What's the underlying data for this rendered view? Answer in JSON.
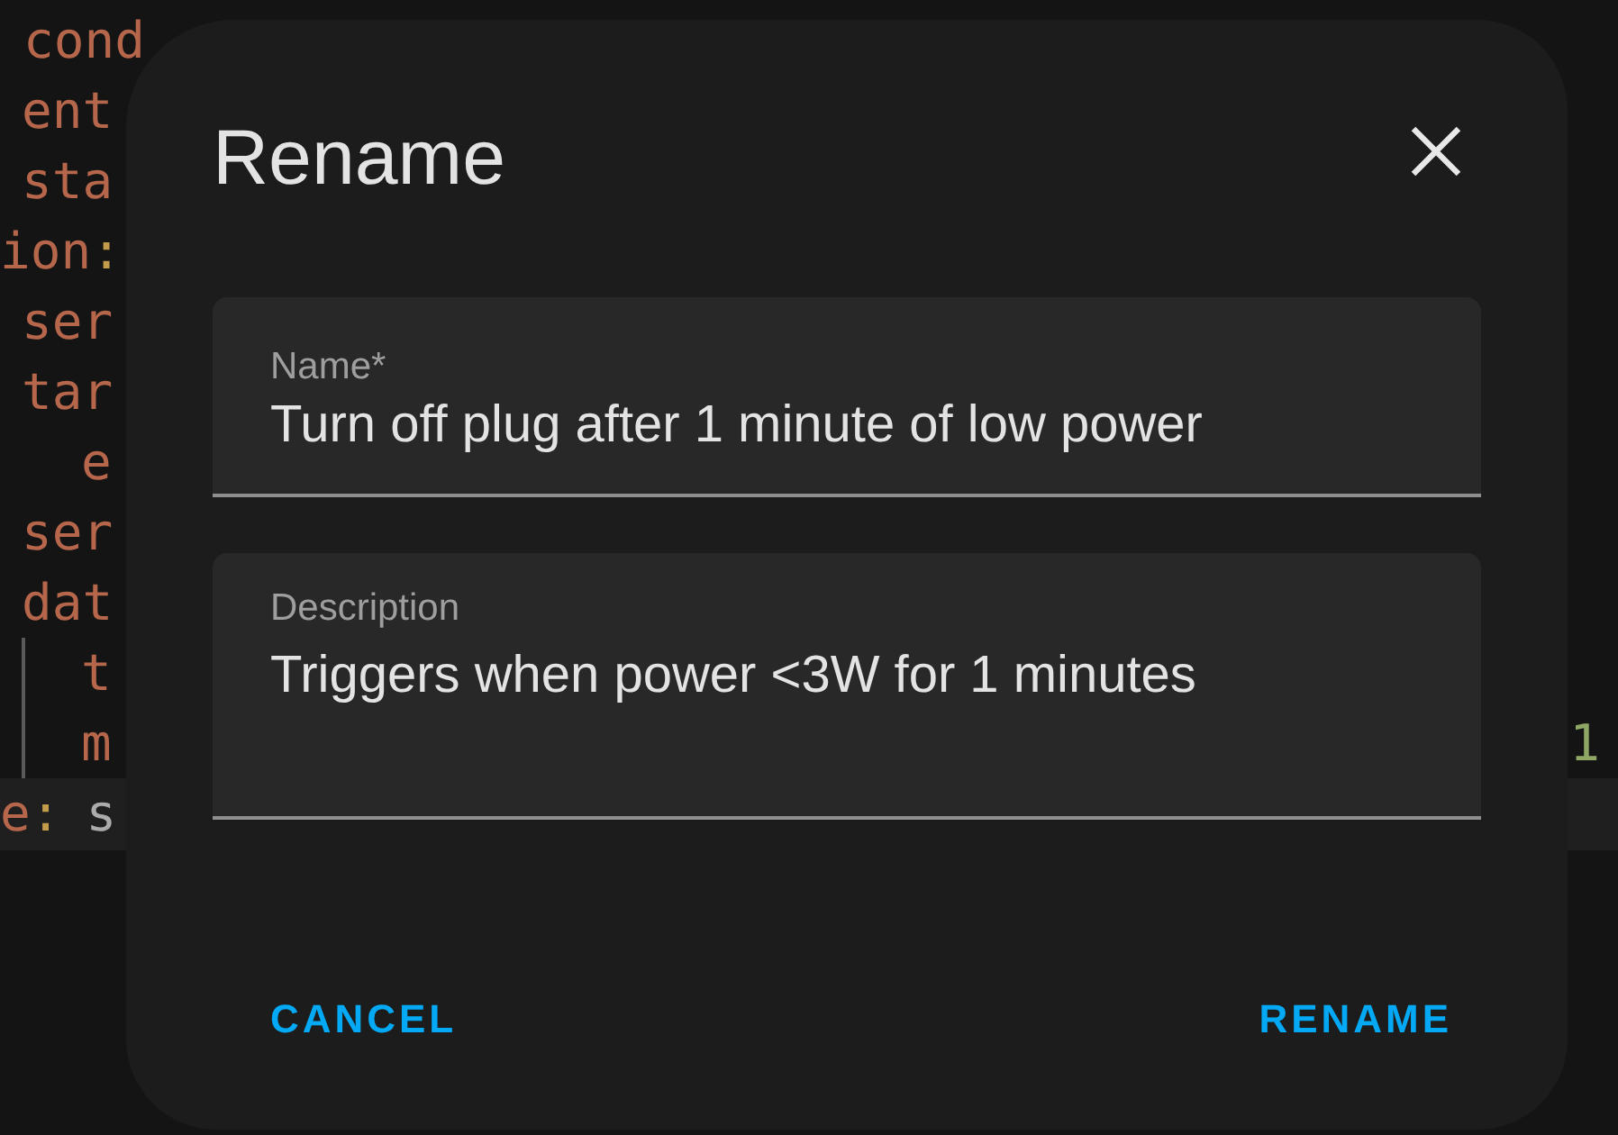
{
  "editor": {
    "lines": [
      {
        "key": "cond",
        "active": false
      },
      {
        "key": "ent",
        "active": false
      },
      {
        "key": "sta",
        "active": false
      },
      {
        "key": "ion",
        "punct": ":",
        "active": false
      },
      {
        "key": "ser",
        "active": false
      },
      {
        "key": "tar",
        "active": false
      },
      {
        "key": "e",
        "active": false
      },
      {
        "key": "ser",
        "active": false
      },
      {
        "key": "dat",
        "active": false
      },
      {
        "key": "t",
        "active": false
      },
      {
        "key": "m",
        "tail": "1",
        "active": false
      },
      {
        "key": "e",
        "punct": ":",
        "value": "s",
        "active": true
      }
    ]
  },
  "dialog": {
    "title": "Rename",
    "fields": [
      {
        "kind": "text",
        "label": "Name*",
        "value": "Turn off plug after 1 minute of low power"
      },
      {
        "kind": "textarea",
        "label": "Description",
        "value": "Triggers when power <3W for 1 minutes"
      }
    ],
    "buttons": [
      "CANCEL",
      "RENAME"
    ]
  }
}
